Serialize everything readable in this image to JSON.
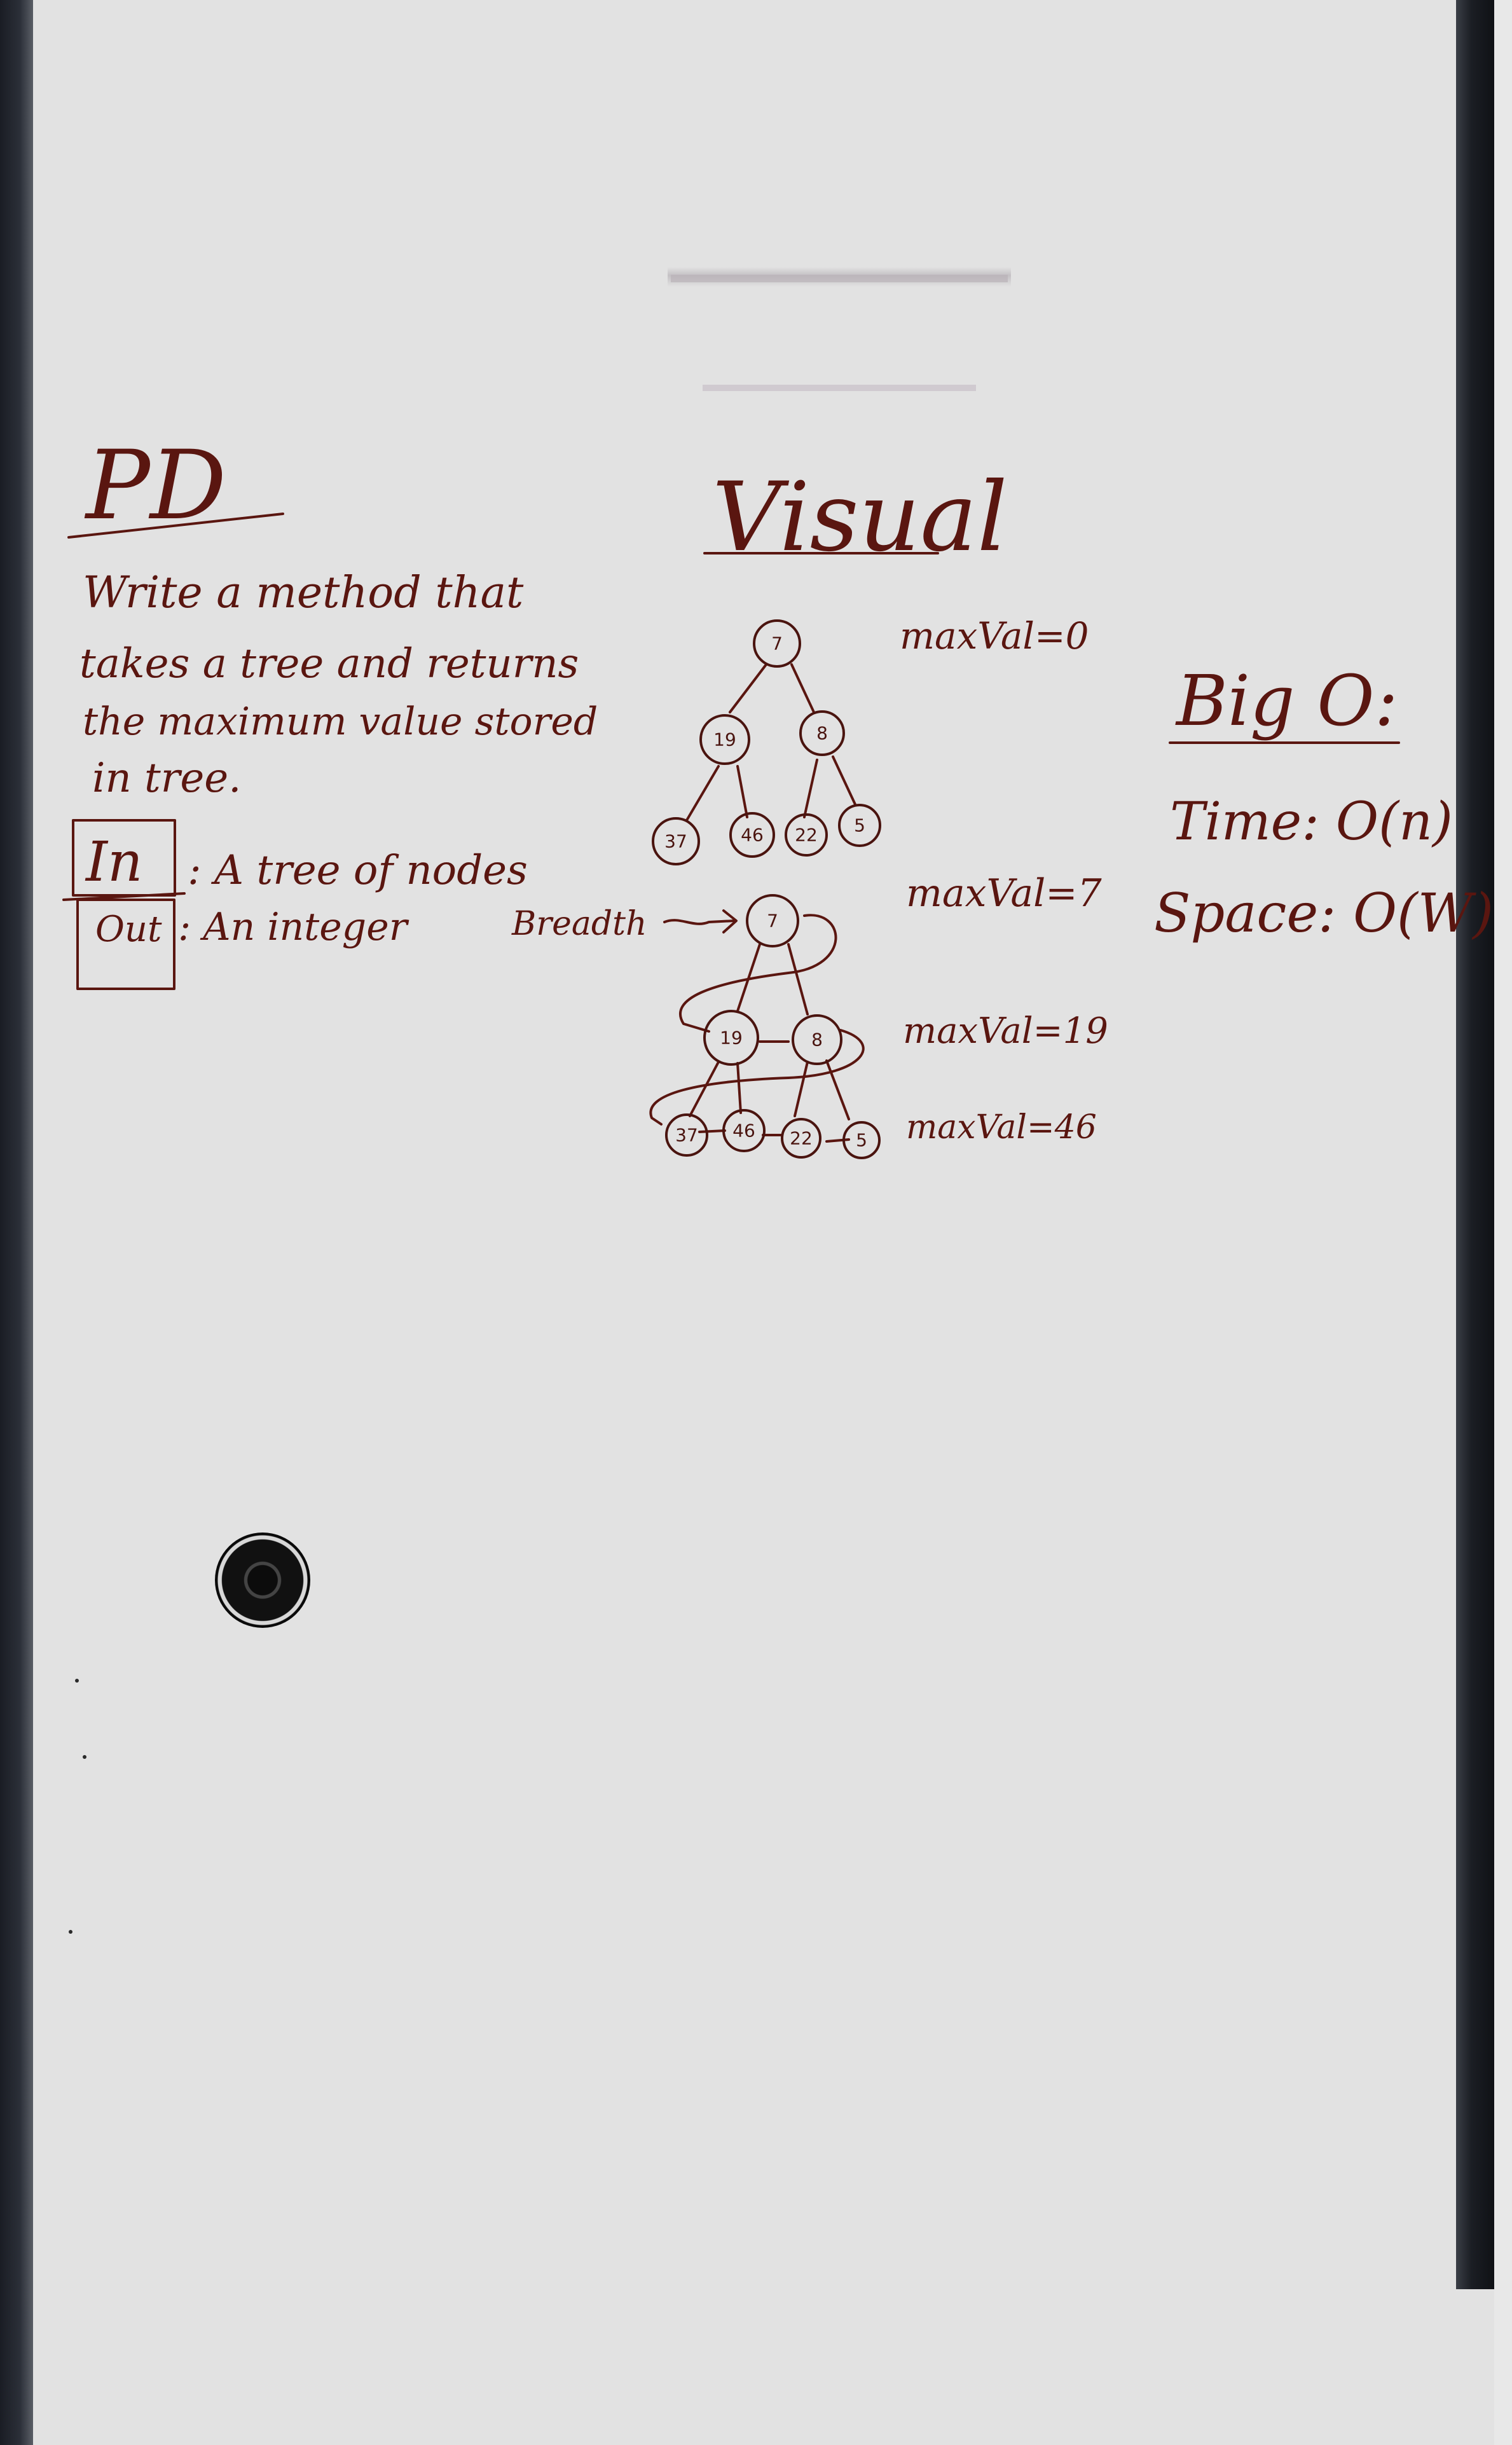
{
  "pd": {
    "heading": "PD",
    "description": [
      "Write a method that",
      "takes a tree and returns",
      "the maximum value stored",
      "in tree."
    ],
    "input_label": "In",
    "input_text": ": A tree of nodes",
    "output_label": "Out",
    "output_text": ": An integer"
  },
  "visual": {
    "heading": "Visual",
    "breadth_label": "Breadth",
    "annotations": [
      "maxVal=0",
      "maxVal=7",
      "maxVal=19",
      "maxVal=46"
    ],
    "tree_top": {
      "root": "7",
      "level1": [
        "19",
        "8"
      ],
      "level2": [
        "37",
        "46",
        "22",
        "5"
      ]
    },
    "tree_bottom": {
      "root": "7",
      "level1": [
        "19",
        "8"
      ],
      "level2": [
        "37",
        "46",
        "22",
        "5"
      ]
    }
  },
  "big_o": {
    "heading": "Big O:",
    "time": "Time: O(n)",
    "space": "Space: O(W)"
  },
  "colors": {
    "ink": "#5a1610",
    "board": "#e2e2e2",
    "frame": "#1b1e24"
  }
}
